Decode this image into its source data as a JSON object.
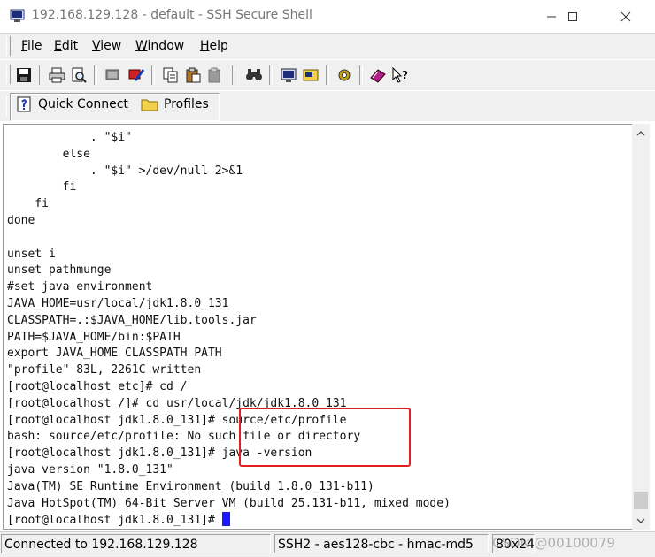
{
  "window": {
    "title": "192.168.129.128 - default - SSH Secure Shell",
    "minimize": "—",
    "maximize": "☐",
    "close": "✕"
  },
  "menu": {
    "items": [
      {
        "first": "F",
        "rest": "ile"
      },
      {
        "first": "E",
        "rest": "dit"
      },
      {
        "first": "V",
        "rest": "iew"
      },
      {
        "first": "W",
        "rest": "indow"
      },
      {
        "first": "H",
        "rest": "elp"
      }
    ]
  },
  "toolbar": {
    "icons": [
      "save-icon",
      "print-icon",
      "print-preview-icon",
      "disconnect-icon",
      "connect-icon",
      "copy-icon",
      "paste-icon",
      "paste-alt-icon",
      "find-icon",
      "settings-icon",
      "profile-settings-icon",
      "configure-icon",
      "help-book-icon",
      "context-help-icon"
    ]
  },
  "quickbar": {
    "quick_connect": "Quick Connect",
    "profiles": "Profiles"
  },
  "terminal": {
    "lines": [
      "            . \"$i\"",
      "        else",
      "            . \"$i\" >/dev/null 2>&1",
      "        fi",
      "    fi",
      "done",
      "",
      "unset i",
      "unset pathmunge",
      "#set java environment",
      "JAVA_HOME=usr/local/jdk1.8.0_131",
      "CLASSPATH=.:$JAVA_HOME/lib.tools.jar",
      "PATH=$JAVA_HOME/bin:$PATH",
      "export JAVA_HOME CLASSPATH PATH",
      "\"profile\" 83L, 2261C written",
      "[root@localhost etc]# cd /",
      "[root@localhost /]# cd usr/local/jdk/jdk1.8.0_131",
      "[root@localhost jdk1.8.0_131]# source/etc/profile",
      "bash: source/etc/profile: No such file or directory",
      "[root@localhost jdk1.8.0_131]# java -version",
      "java version \"1.8.0_131\"",
      "Java(TM) SE Runtime Environment (build 1.8.0_131-b11)",
      "Java HotSpot(TM) 64-Bit Server VM (build 25.131-b11, mixed mode)"
    ],
    "prompt": "[root@localhost jdk1.8.0_131]# "
  },
  "status": {
    "connection": "Connected to 192.168.129.128",
    "cipher": "SSH2 - aes128-cbc - hmac-md5",
    "size": "80x24"
  },
  "watermark": "CSDN @00100079"
}
